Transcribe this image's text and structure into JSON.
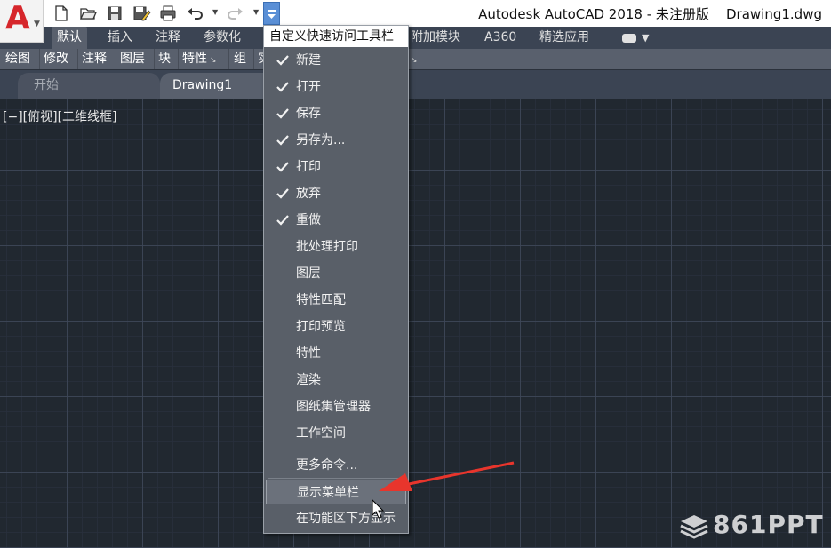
{
  "app": {
    "window_title": "Autodesk AutoCAD 2018 - 未注册版    Drawing1.dwg",
    "logo_letter": "A",
    "accent_color": "#d6262b"
  },
  "quick_access": {
    "icons": [
      "new-icon",
      "open-icon",
      "save-icon",
      "save-as-icon",
      "plot-icon",
      "undo-icon",
      "redo-icon",
      "customize-dropdown-icon"
    ]
  },
  "ribbon": {
    "tabs": [
      {
        "label": "默认",
        "active": true
      },
      {
        "label": "插入"
      },
      {
        "label": "注释"
      },
      {
        "label": "参数化"
      },
      {
        "label": "附加模块"
      },
      {
        "label": "A360"
      },
      {
        "label": "精选应用"
      }
    ],
    "panels": [
      {
        "label": "绘图"
      },
      {
        "label": "修改"
      },
      {
        "label": "注释"
      },
      {
        "label": "图层"
      },
      {
        "label": "块"
      },
      {
        "label": "特性",
        "expander": "↘"
      },
      {
        "label": "组"
      },
      {
        "label": "实"
      }
    ],
    "panel_trailing_expander": "↘"
  },
  "file_tabs": [
    {
      "label": "开始",
      "active": false
    },
    {
      "label": "Drawing1",
      "active": true
    }
  ],
  "viewport": {
    "label": "[−][俯视][二维线框]"
  },
  "qat_menu": {
    "title": "自定义快速访问工具栏",
    "items": [
      {
        "label": "新建",
        "checked": true
      },
      {
        "label": "打开",
        "checked": true
      },
      {
        "label": "保存",
        "checked": true
      },
      {
        "label": "另存为...",
        "checked": true
      },
      {
        "label": "打印",
        "checked": true
      },
      {
        "label": "放弃",
        "checked": true
      },
      {
        "label": "重做",
        "checked": true
      },
      {
        "label": "批处理打印",
        "checked": false
      },
      {
        "label": "图层",
        "checked": false
      },
      {
        "label": "特性匹配",
        "checked": false
      },
      {
        "label": "打印预览",
        "checked": false
      },
      {
        "label": "特性",
        "checked": false
      },
      {
        "label": "渲染",
        "checked": false
      },
      {
        "label": "图纸集管理器",
        "checked": false
      },
      {
        "label": "工作空间",
        "checked": false
      }
    ],
    "more_commands": "更多命令...",
    "show_menu_bar": "显示菜单栏",
    "show_below_ribbon": "在功能区下方显示"
  },
  "annotation": {
    "arrow_color": "#e8352c"
  },
  "watermark": {
    "text": "861PPT"
  }
}
